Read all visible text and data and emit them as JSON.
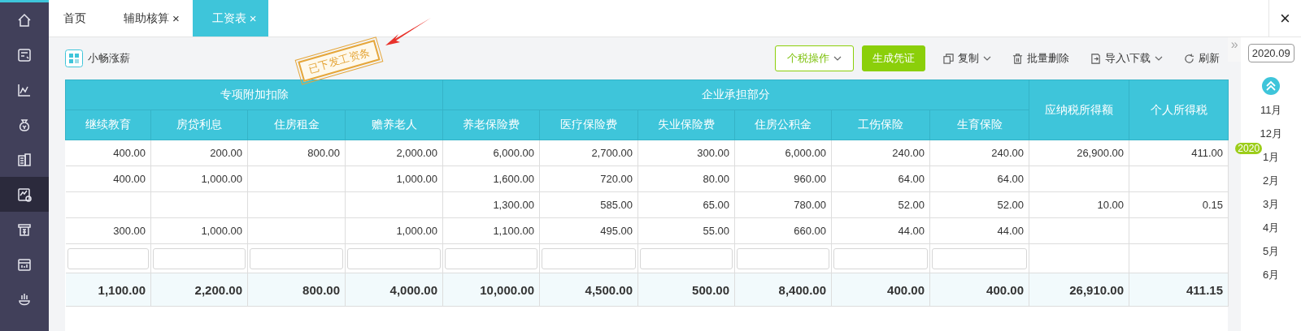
{
  "sidebar": {
    "items": [
      {
        "selected": false
      },
      {
        "selected": false
      },
      {
        "selected": false
      },
      {
        "selected": false
      },
      {
        "selected": false
      },
      {
        "selected": true
      },
      {
        "selected": false
      },
      {
        "selected": false
      },
      {
        "selected": false
      }
    ]
  },
  "tabs": [
    {
      "label": "首页",
      "selected": false
    },
    {
      "label": "辅助核算",
      "close": "×",
      "selected": false
    },
    {
      "label": "工资表",
      "close": "×",
      "selected": true
    }
  ],
  "window_close": "×",
  "toolbar": {
    "brand": "小畅涨薪",
    "stamp": "已下发工资条",
    "buttons": [
      {
        "label": "个税操作",
        "kind": "outline",
        "dropdown": true
      },
      {
        "label": "生成凭证",
        "kind": "primary",
        "dropdown": false
      },
      {
        "label": "复制",
        "kind": "text",
        "dropdown": true
      },
      {
        "label": "批量删除",
        "kind": "text",
        "dropdown": false
      },
      {
        "label": "导入\\下载",
        "kind": "text",
        "dropdown": true
      },
      {
        "label": "刷新",
        "kind": "text",
        "dropdown": false
      }
    ]
  },
  "table": {
    "groups": [
      {
        "label": "专项附加扣除",
        "columns": [
          "继续教育",
          "房贷利息",
          "住房租金",
          "赡养老人"
        ]
      },
      {
        "label": "企业承担部分",
        "columns": [
          "养老保险费",
          "医疗保险费",
          "失业保险费",
          "住房公积金",
          "工伤保险",
          "生育保险"
        ]
      },
      {
        "label": "应纳税所得额"
      },
      {
        "label": "个人所得税"
      }
    ],
    "rows": [
      [
        "400.00",
        "200.00",
        "800.00",
        "2,000.00",
        "6,000.00",
        "2,700.00",
        "300.00",
        "6,000.00",
        "240.00",
        "240.00",
        "26,900.00",
        "411.00"
      ],
      [
        "400.00",
        "1,000.00",
        null,
        "1,000.00",
        "1,600.00",
        "720.00",
        "80.00",
        "960.00",
        "64.00",
        "64.00",
        null,
        null
      ],
      [
        null,
        null,
        null,
        null,
        "1,300.00",
        "585.00",
        "65.00",
        "780.00",
        "52.00",
        "52.00",
        "10.00",
        "0.15"
      ],
      [
        "300.00",
        "1,000.00",
        null,
        "1,000.00",
        "1,100.00",
        "495.00",
        "55.00",
        "660.00",
        "44.00",
        "44.00",
        null,
        null
      ]
    ],
    "totals": [
      "1,100.00",
      "2,200.00",
      "800.00",
      "4,000.00",
      "10,000.00",
      "4,500.00",
      "500.00",
      "8,400.00",
      "400.00",
      "400.00",
      "26,910.00",
      "411.15"
    ]
  },
  "period_panel": {
    "toggle": "»",
    "period": "2020.09",
    "months": [
      {
        "label": "11月"
      },
      {
        "label": "12月"
      },
      {
        "label": "1月",
        "year_badge": "2020"
      },
      {
        "label": "2月"
      },
      {
        "label": "3月"
      },
      {
        "label": "4月"
      },
      {
        "label": "5月"
      },
      {
        "label": "6月"
      }
    ]
  }
}
